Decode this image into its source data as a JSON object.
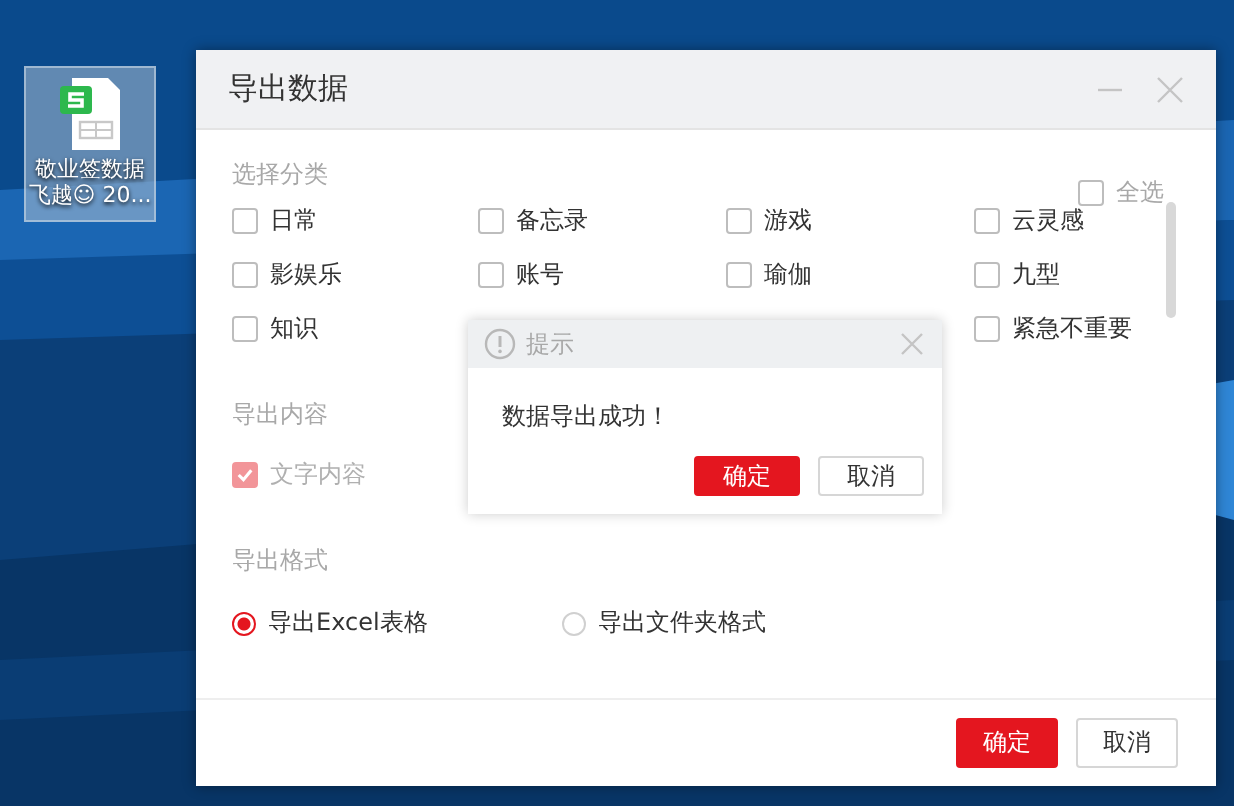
{
  "desktop_icon": {
    "label": "敬业签数据飞越☺ 20...",
    "selected": true
  },
  "window": {
    "title": "导出数据"
  },
  "category_section": {
    "heading": "选择分类",
    "select_all": {
      "label": "全选",
      "checked": false
    },
    "rows": [
      [
        {
          "label": "日常",
          "checked": false
        },
        {
          "label": "备忘录",
          "checked": false
        },
        {
          "label": "游戏",
          "checked": false
        },
        {
          "label": "云灵感",
          "checked": false
        }
      ],
      [
        {
          "label": "影娱乐",
          "checked": false
        },
        {
          "label": "账号",
          "checked": false
        },
        {
          "label": "瑜伽",
          "checked": false
        },
        {
          "label": "九型",
          "checked": false
        }
      ],
      [
        {
          "label": "知识",
          "checked": false
        },
        null,
        null,
        {
          "label": "紧急不重要",
          "checked": false
        }
      ]
    ]
  },
  "content_section": {
    "heading": "导出内容",
    "options": [
      {
        "label": "文字内容",
        "checked": true,
        "disabled": true
      }
    ]
  },
  "format_section": {
    "heading": "导出格式",
    "options": [
      {
        "label": "导出Excel表格",
        "selected": true
      },
      {
        "label": "导出文件夹格式",
        "selected": false
      }
    ]
  },
  "buttons": [
    {
      "label": "确定",
      "kind": "primary"
    },
    {
      "label": "取消",
      "kind": "secondary"
    }
  ],
  "popup": {
    "title": "提示",
    "message": "数据导出成功！",
    "buttons": [
      {
        "label": "确定",
        "kind": "primary"
      },
      {
        "label": "取消",
        "kind": "secondary"
      }
    ]
  }
}
